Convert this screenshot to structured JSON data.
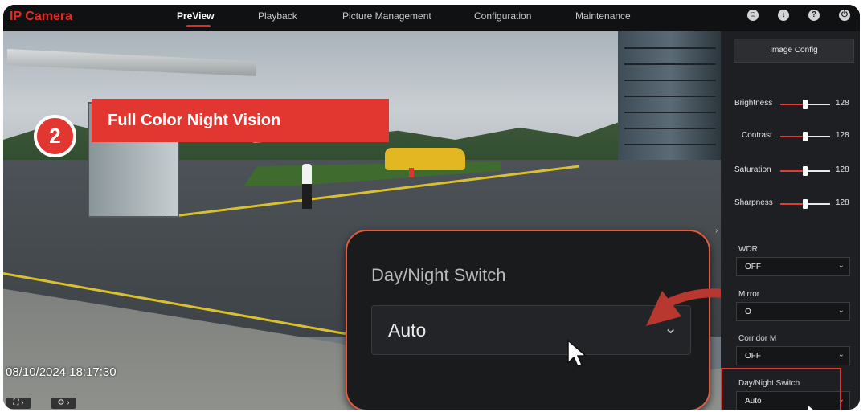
{
  "app": {
    "brand": "IP Camera"
  },
  "nav": {
    "tabs": [
      {
        "label": "PreView",
        "active": true
      },
      {
        "label": "Playback",
        "active": false
      },
      {
        "label": "Picture Management",
        "active": false
      },
      {
        "label": "Configuration",
        "active": false
      },
      {
        "label": "Maintenance",
        "active": false
      }
    ],
    "icons": [
      "user-icon",
      "download-icon",
      "help-icon",
      "power-icon"
    ]
  },
  "video": {
    "timestamp": "08/10/2024  18:17:30",
    "step_badge": "②",
    "title_banner": "Full Color Night Vision"
  },
  "zoom_callout": {
    "label": "Day/Night Switch",
    "value": "Auto"
  },
  "panel": {
    "header_button": "Image Config",
    "sliders": [
      {
        "label": "Brightness",
        "value": "128",
        "level": 0.5
      },
      {
        "label": "Contrast",
        "value": "128",
        "level": 0.5
      },
      {
        "label": "Saturation",
        "value": "128",
        "level": 0.5
      },
      {
        "label": "Sharpness",
        "value": "128",
        "level": 0.5
      }
    ],
    "fields": [
      {
        "label": "WDR",
        "value": "OFF"
      },
      {
        "label": "Mirror",
        "value": "O"
      },
      {
        "label": "Corridor M",
        "value": "OFF"
      },
      {
        "label": "Day/Night Switch",
        "value": "Auto"
      }
    ]
  },
  "colors": {
    "accent": "#e23631",
    "panel_bg": "#1e1f22",
    "topbar_bg": "#101113"
  }
}
